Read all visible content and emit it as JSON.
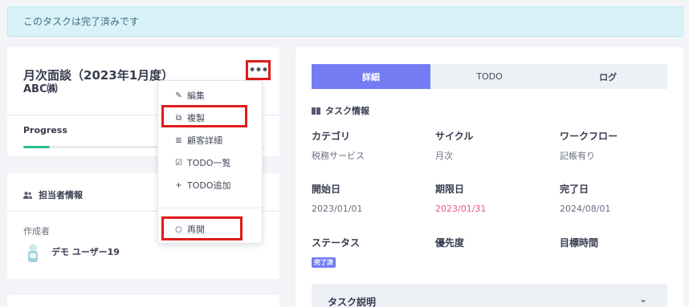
{
  "alert": {
    "text": "このタスクは完了済みです"
  },
  "task": {
    "title": "月次面談（2023年1月度）",
    "client": "ABC㈱",
    "more_label": "•••",
    "progress_label": "Progress",
    "progress_value": 0.11
  },
  "menu": {
    "items": [
      {
        "label": "編集",
        "icon": "pencil-icon",
        "glyph": "✎"
      },
      {
        "label": "複製",
        "icon": "copy-icon",
        "glyph": "⧉"
      },
      {
        "label": "顧客詳細",
        "icon": "list-icon",
        "glyph": "≣"
      },
      {
        "label": "TODO一覧",
        "icon": "checkbox-icon",
        "glyph": "☑"
      },
      {
        "label": "TODO追加",
        "icon": "plus-icon",
        "glyph": "+"
      },
      {
        "label": "再開",
        "icon": "circle-icon",
        "glyph": "○"
      }
    ]
  },
  "owner": {
    "heading": "担当者情報",
    "creator_label": "作成者",
    "creator_name": "デモ ユーザー19"
  },
  "detail": {
    "tabs": [
      "詳細",
      "TODO",
      "ログ"
    ],
    "active_tab": "詳細",
    "section_title": "タスク情報",
    "fields": {
      "category": {
        "label": "カテゴリ",
        "value": "税務サービス"
      },
      "cycle": {
        "label": "サイクル",
        "value": "月次"
      },
      "workflow": {
        "label": "ワークフロー",
        "value": "記帳有り"
      },
      "start_date": {
        "label": "開始日",
        "value": "2023/01/01"
      },
      "due_date": {
        "label": "期限日",
        "value": "2023/01/31"
      },
      "done_date": {
        "label": "完了日",
        "value": "2024/08/01"
      },
      "status": {
        "label": "ステータス",
        "value": "完了済"
      },
      "priority": {
        "label": "優先度"
      },
      "target_time": {
        "label": "目標時間"
      }
    },
    "description_title": "タスク説明",
    "description_chevron": "⌄"
  },
  "colors": {
    "accent": "#737cf2",
    "highlight": "#e01b1b",
    "progress": "#2bc38a",
    "due_red": "#e85a7a",
    "alert_bg": "#d8f2f8"
  }
}
